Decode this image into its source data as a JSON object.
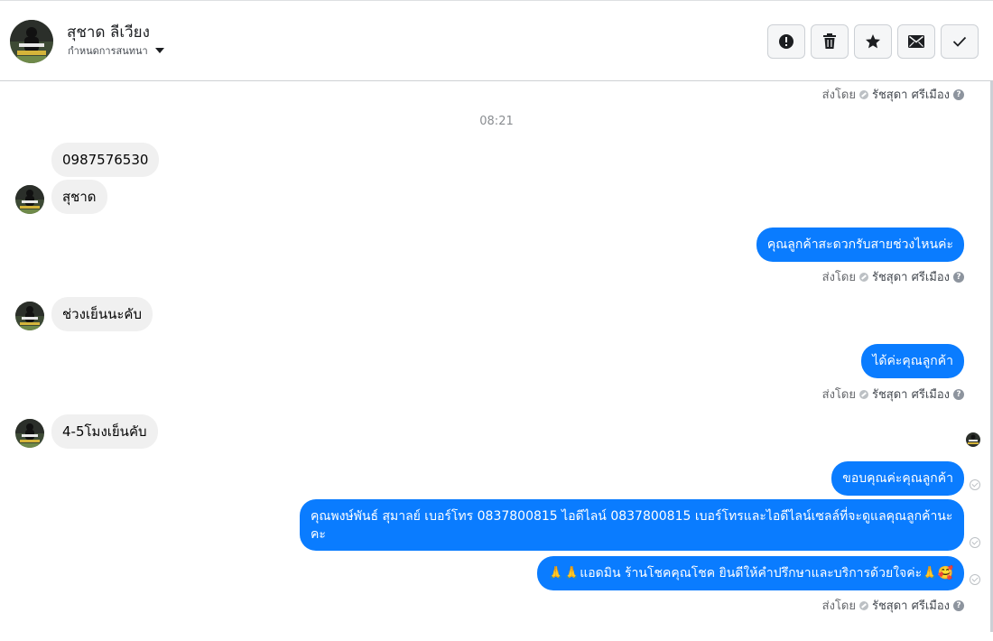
{
  "header": {
    "contact_name": "สุชาด ลีเวียง",
    "assign_label": "กำหนดการสนทนา",
    "actions": [
      {
        "name": "mark-as-spam-button",
        "icon": "alert-icon"
      },
      {
        "name": "delete-button",
        "icon": "trash-icon"
      },
      {
        "name": "star-button",
        "icon": "star-icon"
      },
      {
        "name": "mark-unread-button",
        "icon": "envelope-icon"
      },
      {
        "name": "mark-done-button",
        "icon": "check-icon"
      }
    ]
  },
  "sent_by": {
    "prefix": "ส่งโดย",
    "sender": "รัชสุดา ศรีเมือง",
    "help": "?"
  },
  "timestamp": "08:21",
  "messages_in": [
    {
      "text": "0987576530"
    },
    {
      "text": "สุชาด"
    },
    {
      "text": "ช่วงเย็นนะคับ"
    },
    {
      "text": "4-5โมงเย็นคับ"
    }
  ],
  "messages_out": [
    {
      "text": "คุณลูกค้าสะดวกรับสายช่วงไหนค่ะ"
    },
    {
      "text": "ได้ค่ะคุณลูกค้า"
    },
    {
      "text": "ขอบคุณค่ะคุณลูกค้า"
    },
    {
      "text": "คุณพงษ์พันธ์ สุมาลย์      เบอร์โทร 0837800815  ไอดีไลน์ 0837800815   เบอร์โทรและไอดีไลน์เซลล์ที่จะดูแลคุณลูกค้านะคะ"
    },
    {
      "text": "🙏🙏แอดมิน ร้านโชคคุณโชค ยินดีให้คำปรึกษาและบริการด้วยใจค่ะ🙏🥰"
    }
  ],
  "colors": {
    "outgoing_bubble": "#0a7cff",
    "incoming_bubble": "#f0f0f0",
    "muted_text": "#65676b"
  }
}
